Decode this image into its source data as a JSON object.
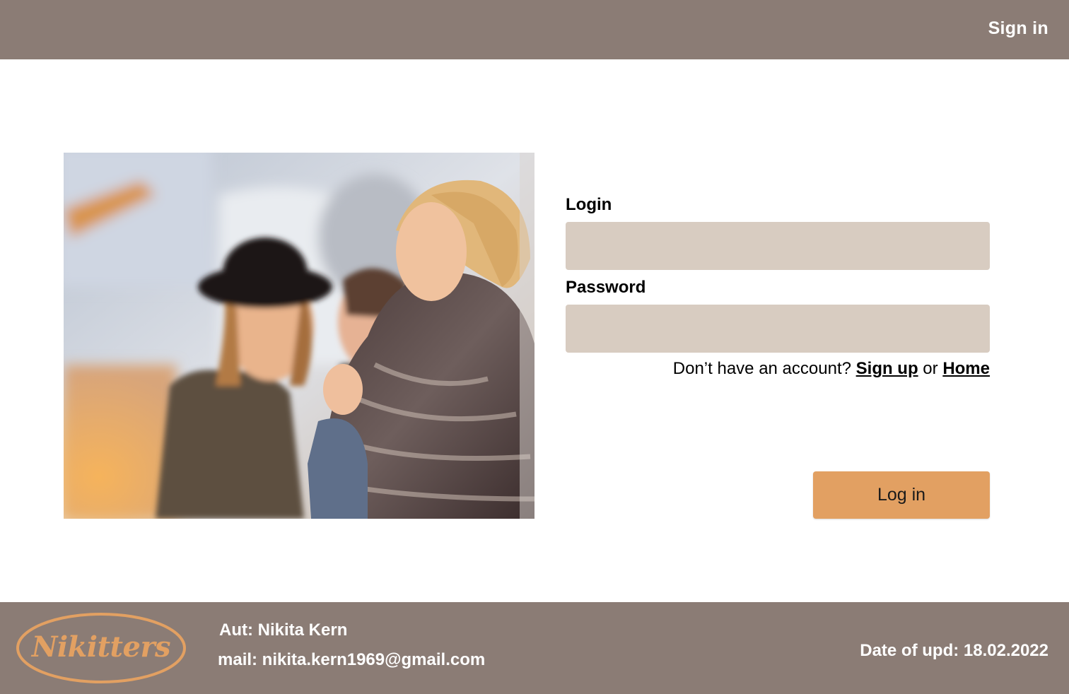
{
  "header": {
    "sign_in_label": "Sign in"
  },
  "photo": {
    "description_icon": "group-of-friends-photo"
  },
  "form": {
    "login_label": "Login",
    "login_value": "",
    "password_label": "Password",
    "password_value": "",
    "no_account_text": "Don’t have an account?",
    "sign_up_label": "Sign up",
    "or_text": "or",
    "home_label": "Home",
    "submit_label": "Log in"
  },
  "footer": {
    "logo_text": "Nikitters",
    "author": "Aut: Nikita Kern",
    "mail": "mail: nikita.kern1969@gmail.com",
    "update_date": "Date of upd: 18.02.2022"
  },
  "colors": {
    "bar": "#8b7c75",
    "input_bg": "#d8ccc1",
    "accent": "#e2a062",
    "text": "#000000",
    "bar_text": "#ffffff"
  }
}
